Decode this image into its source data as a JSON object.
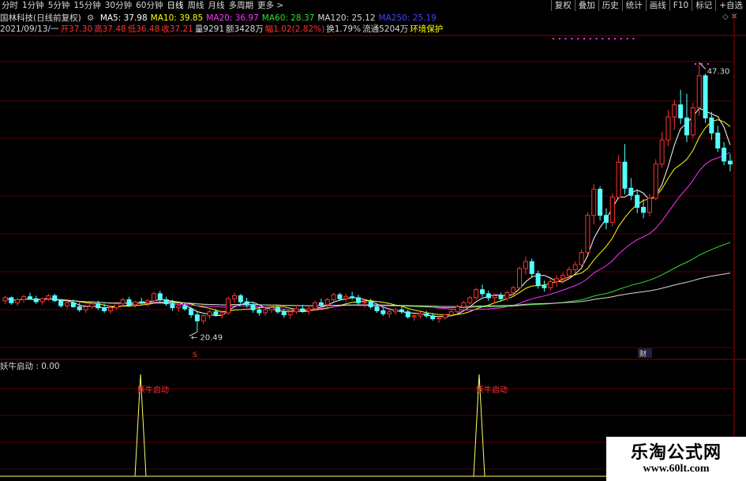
{
  "toolbar": {
    "periods": [
      "分时",
      "1分钟",
      "5分钟",
      "15分钟",
      "30分钟",
      "60分钟",
      "日线",
      "周线",
      "月线",
      "多周期",
      "更多 >"
    ],
    "tools": [
      "复权",
      "叠加",
      "历史",
      "统计",
      "画线",
      "F10",
      "标记",
      "+自选"
    ]
  },
  "header": {
    "stock_title": "国林科技(日线前复权)",
    "ma_items": [
      {
        "label": "MA5: 37.98",
        "color": "#ffffff"
      },
      {
        "label": "MA10: 39.85",
        "color": "#ffff00"
      },
      {
        "label": "MA20: 36.97",
        "color": "#ff33ff"
      },
      {
        "label": "MA60: 28.37",
        "color": "#33dd33"
      },
      {
        "label": "MA120: 25.12",
        "color": "#d8d8d8"
      },
      {
        "label": "MA250: 25.19",
        "color": "#4444ff"
      }
    ],
    "quote_items": [
      {
        "label": "2021/09/13/一",
        "color": "#d8d8d8"
      },
      {
        "label": "开37.30",
        "color": "#ff3333"
      },
      {
        "label": "高37.48",
        "color": "#ff3333"
      },
      {
        "label": "低36.48",
        "color": "#ff3333"
      },
      {
        "label": "收37.21",
        "color": "#ff3333"
      },
      {
        "label": "量9291",
        "color": "#d8d8d8"
      },
      {
        "label": "额3428万",
        "color": "#d8d8d8"
      },
      {
        "label": "幅1.02(2.82%)",
        "color": "#ff3333"
      },
      {
        "label": "换1.79%",
        "color": "#d8d8d8"
      },
      {
        "label": "流通5204万",
        "color": "#d8d8d8"
      },
      {
        "label": "环境保护",
        "color": "#ffff00"
      }
    ]
  },
  "indicator": {
    "title": "妖牛启动 : 0.00",
    "signal_label": "妖牛启动"
  },
  "watermark": {
    "line1": "乐淘公式网",
    "line2": "www.60lt.com"
  },
  "markers": {
    "s_mark": "S",
    "finance_mark": "财"
  },
  "chart_data": {
    "type": "candlestick",
    "price_range": [
      18,
      50
    ],
    "annotations": {
      "high_label": "47.30",
      "low_label": "20.49"
    },
    "candles": [
      [
        23.6,
        24.1,
        23.3,
        23.9
      ],
      [
        23.9,
        24.0,
        23.2,
        23.4
      ],
      [
        23.4,
        23.9,
        23.1,
        23.7
      ],
      [
        23.7,
        24.2,
        23.4,
        24.0
      ],
      [
        24.0,
        24.4,
        23.7,
        23.8
      ],
      [
        23.8,
        24.1,
        23.3,
        23.5
      ],
      [
        23.5,
        23.9,
        23.2,
        23.8
      ],
      [
        23.8,
        24.3,
        23.6,
        24.1
      ],
      [
        24.1,
        24.3,
        23.5,
        23.6
      ],
      [
        23.6,
        23.8,
        22.9,
        23.1
      ],
      [
        23.1,
        23.6,
        22.8,
        23.4
      ],
      [
        23.4,
        23.7,
        22.9,
        23.0
      ],
      [
        23.0,
        23.4,
        22.5,
        22.7
      ],
      [
        22.7,
        23.2,
        22.4,
        23.0
      ],
      [
        23.0,
        23.5,
        22.8,
        23.3
      ],
      [
        23.3,
        23.6,
        22.7,
        22.9
      ],
      [
        22.9,
        23.3,
        22.4,
        22.6
      ],
      [
        22.6,
        23.1,
        22.3,
        22.9
      ],
      [
        22.9,
        23.5,
        22.7,
        23.3
      ],
      [
        23.3,
        23.9,
        23.1,
        23.7
      ],
      [
        23.7,
        24.0,
        23.0,
        23.2
      ],
      [
        23.2,
        23.6,
        22.9,
        23.5
      ],
      [
        23.5,
        23.9,
        23.2,
        23.4
      ],
      [
        23.4,
        23.8,
        23.0,
        23.6
      ],
      [
        23.6,
        24.5,
        23.4,
        24.3
      ],
      [
        24.3,
        24.6,
        23.5,
        23.7
      ],
      [
        23.7,
        24.0,
        23.1,
        23.3
      ],
      [
        23.3,
        23.7,
        22.6,
        22.9
      ],
      [
        22.9,
        23.3,
        22.5,
        23.1
      ],
      [
        23.1,
        23.4,
        22.6,
        22.8
      ],
      [
        22.8,
        23.0,
        21.9,
        22.2
      ],
      [
        22.2,
        22.5,
        20.49,
        21.6
      ],
      [
        21.6,
        22.4,
        21.3,
        22.1
      ],
      [
        22.1,
        22.7,
        21.8,
        22.5
      ],
      [
        22.5,
        22.8,
        22.0,
        22.2
      ],
      [
        22.2,
        22.6,
        21.8,
        22.4
      ],
      [
        22.4,
        24.0,
        22.2,
        23.8
      ],
      [
        23.8,
        24.4,
        23.4,
        24.1
      ],
      [
        24.1,
        24.3,
        23.2,
        23.5
      ],
      [
        23.5,
        23.9,
        22.9,
        23.2
      ],
      [
        23.2,
        23.5,
        22.4,
        22.7
      ],
      [
        22.7,
        23.0,
        22.1,
        22.4
      ],
      [
        22.4,
        22.9,
        22.1,
        22.7
      ],
      [
        22.7,
        23.2,
        22.4,
        22.9
      ],
      [
        22.9,
        23.1,
        22.3,
        22.5
      ],
      [
        22.5,
        22.8,
        21.9,
        22.2
      ],
      [
        22.2,
        22.6,
        21.8,
        22.5
      ],
      [
        22.5,
        23.0,
        22.3,
        22.8
      ],
      [
        22.8,
        23.2,
        22.4,
        22.6
      ],
      [
        22.6,
        23.0,
        22.2,
        22.8
      ],
      [
        22.8,
        23.6,
        22.6,
        23.4
      ],
      [
        23.4,
        23.8,
        23.0,
        23.2
      ],
      [
        23.2,
        23.9,
        22.9,
        23.7
      ],
      [
        23.7,
        24.4,
        23.5,
        24.2
      ],
      [
        24.2,
        24.4,
        23.6,
        23.8
      ],
      [
        23.8,
        24.3,
        23.5,
        24.0
      ],
      [
        24.0,
        24.5,
        23.7,
        23.9
      ],
      [
        23.9,
        24.2,
        23.2,
        23.4
      ],
      [
        23.4,
        23.7,
        22.9,
        23.5
      ],
      [
        23.5,
        23.8,
        22.8,
        23.0
      ],
      [
        23.0,
        23.3,
        22.4,
        22.6
      ],
      [
        22.6,
        22.9,
        22.1,
        22.3
      ],
      [
        22.3,
        22.7,
        21.9,
        22.5
      ],
      [
        22.5,
        22.9,
        22.2,
        22.7
      ],
      [
        22.7,
        23.0,
        22.3,
        22.5
      ],
      [
        22.5,
        22.7,
        21.8,
        22.0
      ],
      [
        22.0,
        22.3,
        21.6,
        22.1
      ],
      [
        22.1,
        22.5,
        21.8,
        22.3
      ],
      [
        22.3,
        22.6,
        21.9,
        22.1
      ],
      [
        22.1,
        22.4,
        21.6,
        21.8
      ],
      [
        21.8,
        22.1,
        21.4,
        21.9
      ],
      [
        21.9,
        22.3,
        21.7,
        22.2
      ],
      [
        22.2,
        22.7,
        22.0,
        22.5
      ],
      [
        22.5,
        23.2,
        22.3,
        23.0
      ],
      [
        23.0,
        23.6,
        22.8,
        23.4
      ],
      [
        23.4,
        24.1,
        23.2,
        23.9
      ],
      [
        23.9,
        24.9,
        23.7,
        24.7
      ],
      [
        24.7,
        25.2,
        24.0,
        24.3
      ],
      [
        24.3,
        24.6,
        23.6,
        23.9
      ],
      [
        23.9,
        24.3,
        23.4,
        24.1
      ],
      [
        24.1,
        24.4,
        23.6,
        23.8
      ],
      [
        23.8,
        24.6,
        23.6,
        24.4
      ],
      [
        24.4,
        25.1,
        24.2,
        24.9
      ],
      [
        24.9,
        27.0,
        24.7,
        26.8
      ],
      [
        26.8,
        28.0,
        26.2,
        27.5
      ],
      [
        27.5,
        27.8,
        25.9,
        26.3
      ],
      [
        26.3,
        26.6,
        24.8,
        25.1
      ],
      [
        25.1,
        25.6,
        24.5,
        24.9
      ],
      [
        24.9,
        25.8,
        24.6,
        25.5
      ],
      [
        25.5,
        26.1,
        25.0,
        25.8
      ],
      [
        25.8,
        26.4,
        25.3,
        26.1
      ],
      [
        26.1,
        27.0,
        25.8,
        26.7
      ],
      [
        26.7,
        27.5,
        26.3,
        27.2
      ],
      [
        27.2,
        28.7,
        27.0,
        28.4
      ],
      [
        28.4,
        32.4,
        28.2,
        32.1
      ],
      [
        32.1,
        35.2,
        31.2,
        34.7
      ],
      [
        34.7,
        35.0,
        31.6,
        32.1
      ],
      [
        32.1,
        32.8,
        30.7,
        31.4
      ],
      [
        31.4,
        34.3,
        31.0,
        33.9
      ],
      [
        33.9,
        38.1,
        33.7,
        37.4
      ],
      [
        37.4,
        39.2,
        34.2,
        34.8
      ],
      [
        34.8,
        35.8,
        33.6,
        34.1
      ],
      [
        34.1,
        34.6,
        32.3,
        32.9
      ],
      [
        32.9,
        33.7,
        31.8,
        32.4
      ],
      [
        32.4,
        34.2,
        32.0,
        33.8
      ],
      [
        33.8,
        37.7,
        33.6,
        37.2
      ],
      [
        37.2,
        40.4,
        36.8,
        39.6
      ],
      [
        39.6,
        42.6,
        39.0,
        41.9
      ],
      [
        41.9,
        43.6,
        40.6,
        43.1
      ],
      [
        43.1,
        44.6,
        41.2,
        41.8
      ],
      [
        41.8,
        44.2,
        39.4,
        40.1
      ],
      [
        40.1,
        43.3,
        39.8,
        42.8
      ],
      [
        42.8,
        47.3,
        42.0,
        46.0
      ],
      [
        46.0,
        46.2,
        41.3,
        41.8
      ],
      [
        41.8,
        42.4,
        39.6,
        40.3
      ],
      [
        40.3,
        41.0,
        38.4,
        38.8
      ],
      [
        38.8,
        39.4,
        37.1,
        37.5
      ],
      [
        37.5,
        38.2,
        36.48,
        37.21
      ]
    ]
  }
}
